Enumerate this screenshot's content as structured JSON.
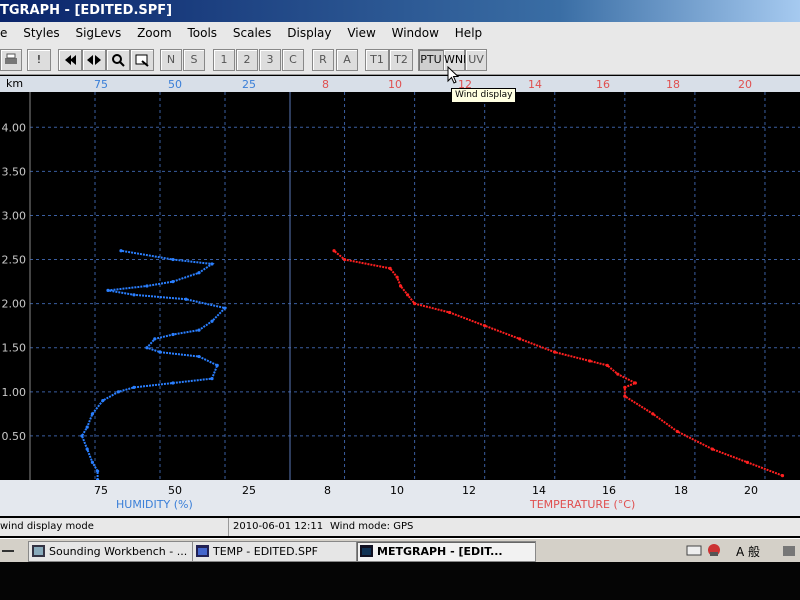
{
  "window": {
    "title": "TGRAPH - [EDITED.SPF]"
  },
  "menu": [
    "e",
    "Styles",
    "SigLevs",
    "Zoom",
    "Tools",
    "Scales",
    "Display",
    "View",
    "Window",
    "Help"
  ],
  "toolbar": {
    "buttons": [
      "!",
      "N",
      "S",
      "1",
      "2",
      "3",
      "C",
      "R",
      "A",
      "T1",
      "T2",
      "PTU",
      "WND",
      "UV"
    ],
    "tooltip": "Wind display"
  },
  "top_axis": {
    "unit_label": "km",
    "humidity_ticks": [
      "75",
      "50",
      "25"
    ],
    "temperature_ticks": [
      "8",
      "10",
      "12",
      "14",
      "16",
      "18",
      "20"
    ]
  },
  "status": {
    "message": "wind display mode",
    "datetime": "2010-06-01 12:11",
    "wind_mode": "Wind mode: GPS"
  },
  "taskbar": {
    "tasks": [
      "Sounding Workbench - ...",
      "TEMP - EDITED.SPF",
      "METGRAPH - [EDIT..."
    ],
    "tray_text": "A 般"
  },
  "colors": {
    "humidity": "#2a7fff",
    "temperature": "#ff2020",
    "grid": "#3a5ea0",
    "humidity_text": "#3a7fd8",
    "temperature_text": "#e05050"
  },
  "chart_data": {
    "type": "line",
    "title": "",
    "y_axis": {
      "label": "km",
      "ylim": [
        0,
        4.4
      ],
      "ticks": [
        "0.50",
        "1.00",
        "1.50",
        "2.00",
        "2.50",
        "3.00",
        "3.50",
        "4.00"
      ]
    },
    "humidity_axis": {
      "label": "HUMIDITY (%)",
      "ticks": [
        "75",
        "50",
        "25"
      ],
      "direction": "decreasing"
    },
    "temperature_axis": {
      "label": "TEMPERATURE (°C)",
      "ticks": [
        "8",
        "10",
        "12",
        "14",
        "16",
        "18",
        "20"
      ],
      "xlim": [
        6.5,
        21
      ]
    },
    "grid": true,
    "series": [
      {
        "name": "HUMIDITY (%)",
        "axis": "humidity",
        "points": [
          [
            74,
            0.0
          ],
          [
            74,
            0.1
          ],
          [
            76,
            0.2
          ],
          [
            78,
            0.35
          ],
          [
            80,
            0.5
          ],
          [
            78,
            0.6
          ],
          [
            76,
            0.75
          ],
          [
            72,
            0.9
          ],
          [
            66,
            1.0
          ],
          [
            60,
            1.05
          ],
          [
            45,
            1.1
          ],
          [
            30,
            1.15
          ],
          [
            28,
            1.3
          ],
          [
            35,
            1.4
          ],
          [
            50,
            1.45
          ],
          [
            55,
            1.5
          ],
          [
            52,
            1.6
          ],
          [
            45,
            1.65
          ],
          [
            35,
            1.7
          ],
          [
            30,
            1.8
          ],
          [
            25,
            1.95
          ],
          [
            40,
            2.05
          ],
          [
            60,
            2.1
          ],
          [
            70,
            2.15
          ],
          [
            55,
            2.2
          ],
          [
            45,
            2.25
          ],
          [
            35,
            2.35
          ],
          [
            30,
            2.45
          ],
          [
            45,
            2.5
          ],
          [
            65,
            2.6
          ]
        ]
      },
      {
        "name": "TEMPERATURE (°C)",
        "axis": "temperature",
        "points": [
          [
            20.5,
            0.05
          ],
          [
            19.5,
            0.2
          ],
          [
            18.5,
            0.35
          ],
          [
            17.5,
            0.55
          ],
          [
            16.8,
            0.75
          ],
          [
            16.0,
            0.95
          ],
          [
            16.0,
            1.05
          ],
          [
            16.3,
            1.1
          ],
          [
            15.8,
            1.2
          ],
          [
            15.5,
            1.3
          ],
          [
            15.0,
            1.35
          ],
          [
            14.0,
            1.45
          ],
          [
            13.0,
            1.6
          ],
          [
            12.0,
            1.75
          ],
          [
            11.0,
            1.9
          ],
          [
            10.0,
            2.0
          ],
          [
            9.8,
            2.1
          ],
          [
            9.6,
            2.2
          ],
          [
            9.5,
            2.3
          ],
          [
            9.3,
            2.4
          ],
          [
            8.0,
            2.5
          ],
          [
            7.7,
            2.6
          ]
        ]
      }
    ]
  }
}
